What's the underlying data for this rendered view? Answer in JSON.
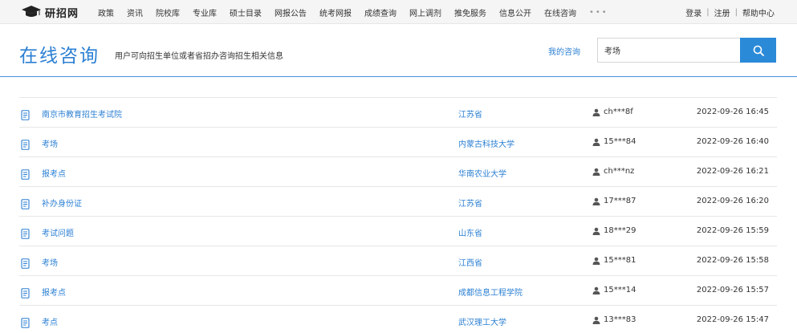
{
  "site": {
    "logo_text": "研招网"
  },
  "nav": {
    "items": [
      "政策",
      "资讯",
      "院校库",
      "专业库",
      "硕士目录",
      "网报公告",
      "统考网报",
      "成绩查询",
      "网上调剂",
      "推免服务",
      "信息公开",
      "在线咨询"
    ],
    "more": "•••"
  },
  "top_links": {
    "login": "登录",
    "register": "注册",
    "help": "帮助中心"
  },
  "header": {
    "title": "在线咨询",
    "subtitle": "用户可向招生单位或者省招办咨询招生相关信息",
    "my_consult": "我的咨询"
  },
  "search": {
    "value": "考场"
  },
  "colors": {
    "accent": "#2b7fd3",
    "button": "#2b8ad8"
  },
  "rows": [
    {
      "title": "南京市教育招生考试院",
      "school": "江苏省",
      "user": "ch***8f",
      "time": "2022-09-26 16:45"
    },
    {
      "title": "考场",
      "school": "内蒙古科技大学",
      "user": "15***84",
      "time": "2022-09-26 16:40"
    },
    {
      "title": "报考点",
      "school": "华南农业大学",
      "user": "ch***nz",
      "time": "2022-09-26 16:21"
    },
    {
      "title": "补办身份证",
      "school": "江苏省",
      "user": "17***87",
      "time": "2022-09-26 16:20"
    },
    {
      "title": "考试问题",
      "school": "山东省",
      "user": "18***29",
      "time": "2022-09-26 15:59"
    },
    {
      "title": "考场",
      "school": "江西省",
      "user": "15***81",
      "time": "2022-09-26 15:58"
    },
    {
      "title": "报考点",
      "school": "成都信息工程学院",
      "user": "15***14",
      "time": "2022-09-26 15:57"
    },
    {
      "title": "考点",
      "school": "武汉理工大学",
      "user": "13***83",
      "time": "2022-09-26 15:47"
    }
  ]
}
